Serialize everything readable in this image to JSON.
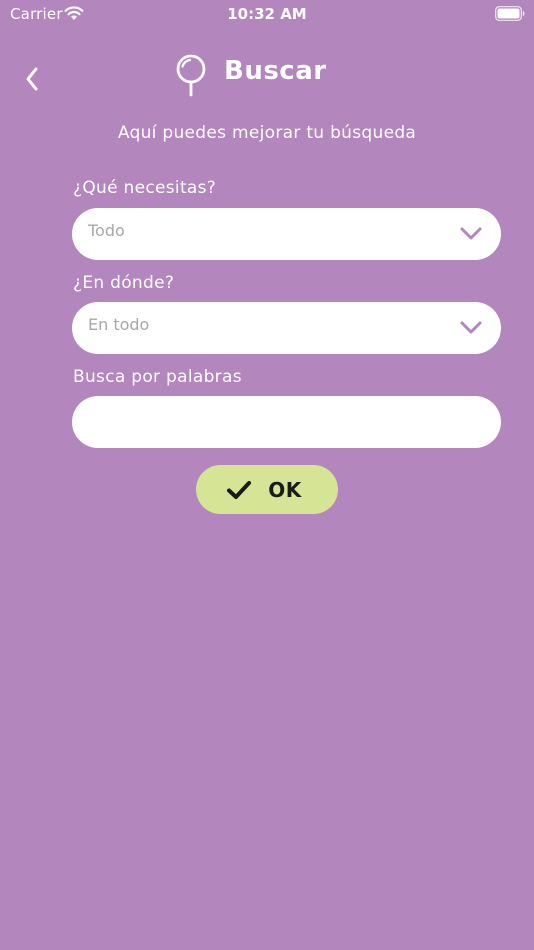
{
  "status_bar": {
    "carrier": "Carrier",
    "time": "10:32 AM",
    "wifi_icon": "wifi-icon",
    "battery_icon": "battery-icon"
  },
  "header": {
    "back_icon": "chevron-left-icon",
    "title_icon": "search-pin-icon",
    "title": "Buscar",
    "subtitle": "Aquí puedes mejorar tu búsqueda"
  },
  "form": {
    "category": {
      "label": "¿Qué necesitas?",
      "value": "Todo",
      "icon": "chevron-down-icon"
    },
    "location": {
      "label": "¿En dónde?",
      "value": "En todo",
      "icon": "chevron-down-icon"
    },
    "keywords": {
      "label": "Busca por palabras",
      "value": "",
      "placeholder": ""
    },
    "submit": {
      "label": "OK",
      "icon": "check-icon"
    }
  },
  "colors": {
    "background": "#b387bd",
    "button": "#d6e495",
    "chevron": "#b387bd",
    "field_text": "#a8a8a8"
  }
}
